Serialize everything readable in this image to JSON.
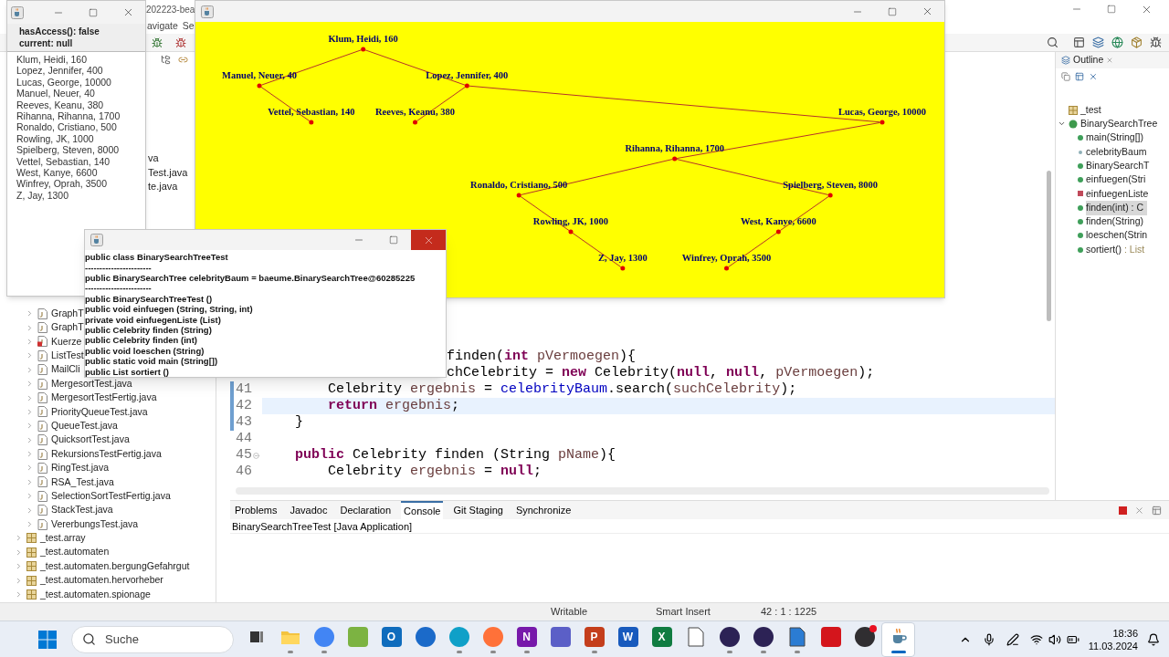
{
  "eclipse": {
    "title": "202223-bea",
    "menu": [
      "avigate",
      "Se"
    ]
  },
  "package_explorer": {
    "fragments": [
      "va",
      "Test.java",
      "te.java"
    ],
    "items": [
      {
        "label": "GraphT",
        "kind": "file",
        "problem": false
      },
      {
        "label": "GraphT",
        "kind": "file",
        "problem": false
      },
      {
        "label": "Kuerze",
        "kind": "file",
        "problem": true
      },
      {
        "label": "ListTest",
        "kind": "file",
        "problem": false
      },
      {
        "label": "MailCli",
        "kind": "file",
        "problem": false
      },
      {
        "label": "MergesortTest.java",
        "kind": "file",
        "problem": false
      },
      {
        "label": "MergesortTestFertig.java",
        "kind": "file",
        "problem": false
      },
      {
        "label": "PriorityQueueTest.java",
        "kind": "file",
        "problem": false
      },
      {
        "label": "QueueTest.java",
        "kind": "file",
        "problem": false
      },
      {
        "label": "QuicksortTest.java",
        "kind": "file",
        "problem": false
      },
      {
        "label": "RekursionsTestFertig.java",
        "kind": "file",
        "problem": false
      },
      {
        "label": "RingTest.java",
        "kind": "file",
        "problem": false
      },
      {
        "label": "RSA_Test.java",
        "kind": "file",
        "problem": false
      },
      {
        "label": "SelectionSortTestFertig.java",
        "kind": "file",
        "problem": false
      },
      {
        "label": "StackTest.java",
        "kind": "file",
        "problem": false
      },
      {
        "label": "VererbungsTest.java",
        "kind": "file",
        "problem": false
      },
      {
        "label": "_test.array",
        "kind": "package"
      },
      {
        "label": "_test.automaten",
        "kind": "package"
      },
      {
        "label": "_test.automaten.bergungGefahrgut",
        "kind": "package"
      },
      {
        "label": "_test.automaten.hervorheber",
        "kind": "package"
      },
      {
        "label": "_test.automaten.spionage",
        "kind": "package"
      }
    ]
  },
  "editor": {
    "lines": [
      {
        "kind": "partial",
        "tokens": [
          {
            "text": "finden(",
            "kind": "plain"
          },
          {
            "text": "int",
            "kind": "kw"
          },
          {
            "text": " pVermoegen",
            "kind": "var"
          },
          {
            "text": "){",
            "kind": "plain"
          }
        ]
      },
      {
        "kind": "partial",
        "tokens": [
          {
            "text": "chCelebrity = ",
            "kind": "plain"
          },
          {
            "text": "new",
            "kind": "kw"
          },
          {
            "text": " Celebrity(",
            "kind": "plain"
          },
          {
            "text": "null",
            "kind": "kw"
          },
          {
            "text": ", ",
            "kind": "plain"
          },
          {
            "text": "null",
            "kind": "kw"
          },
          {
            "text": ", ",
            "kind": "plain"
          },
          {
            "text": "pVermoegen",
            "kind": "var"
          },
          {
            "text": ");",
            "kind": "plain"
          }
        ]
      },
      {
        "kind": "full",
        "number": "41",
        "current": false,
        "changed": true,
        "fold": false,
        "tokens": [
          {
            "text": "        Celebrity ",
            "kind": "plain"
          },
          {
            "text": "ergebnis",
            "kind": "var"
          },
          {
            "text": " = ",
            "kind": "plain"
          },
          {
            "text": "celebrityBaum",
            "kind": "field"
          },
          {
            "text": ".search(",
            "kind": "plain"
          },
          {
            "text": "suchCelebrity",
            "kind": "var"
          },
          {
            "text": ");",
            "kind": "plain"
          }
        ]
      },
      {
        "kind": "full",
        "number": "42",
        "current": true,
        "changed": true,
        "fold": false,
        "tokens": [
          {
            "text": "        return",
            "kind": "kw"
          },
          {
            "text": " ergebnis",
            "kind": "var"
          },
          {
            "text": ";",
            "kind": "plain"
          }
        ]
      },
      {
        "kind": "full",
        "number": "43",
        "current": false,
        "changed": true,
        "fold": false,
        "tokens": [
          {
            "text": "    }",
            "kind": "plain"
          }
        ]
      },
      {
        "kind": "full",
        "number": "44",
        "current": false,
        "changed": false,
        "fold": false
      },
      {
        "kind": "full",
        "number": "45",
        "current": false,
        "changed": false,
        "fold": true,
        "tokens": [
          {
            "text": "    public",
            "kind": "kw"
          },
          {
            "text": " Celebrity finden (String ",
            "kind": "plain"
          },
          {
            "text": "pName",
            "kind": "var"
          },
          {
            "text": "){",
            "kind": "plain"
          }
        ]
      },
      {
        "kind": "full",
        "number": "46",
        "current": false,
        "changed": false,
        "fold": false,
        "tokens": [
          {
            "text": "        Celebrity ",
            "kind": "plain"
          },
          {
            "text": "ergebnis",
            "kind": "var"
          },
          {
            "text": " = ",
            "kind": "plain"
          },
          {
            "text": "null",
            "kind": "kw"
          },
          {
            "text": ";",
            "kind": "plain"
          }
        ]
      }
    ]
  },
  "outline": {
    "title": "Outline",
    "items": [
      {
        "label": "_test",
        "kind": "package",
        "selected": false
      },
      {
        "label": "BinarySearchTree",
        "kind": "class",
        "selected": false,
        "expanded": true,
        "children": [
          {
            "label": "main(String[])",
            "kind": "method",
            "selected": false
          },
          {
            "label": "celebrityBaum",
            "kind": "field",
            "selected": false
          },
          {
            "label": "BinarySearchT",
            "kind": "method",
            "selected": false
          },
          {
            "label": "einfuegen(Stri",
            "kind": "method",
            "selected": false
          },
          {
            "label": "einfuegenListe",
            "kind": "private_method",
            "selected": false
          },
          {
            "label": "finden(int) : C",
            "kind": "method",
            "selected": true
          },
          {
            "label": "finden(String)",
            "kind": "method",
            "selected": false
          },
          {
            "label": "loeschen(Strin",
            "kind": "method",
            "selected": false
          },
          {
            "label": "sortiert()",
            "type": " : List",
            "kind": "method",
            "selected": false
          }
        ]
      }
    ]
  },
  "bottom_panel": {
    "tabs": [
      {
        "label": "Problems",
        "selected": false
      },
      {
        "label": "Javadoc",
        "selected": false
      },
      {
        "label": "Declaration",
        "selected": false
      },
      {
        "label": "Console",
        "selected": true
      },
      {
        "label": "Git Staging",
        "selected": false
      },
      {
        "label": "Synchronize",
        "selected": false
      }
    ],
    "console_title": "BinarySearchTreeTest [Java Application]"
  },
  "status_bar": [
    "Writable",
    "Smart Insert",
    "42 : 1 : 1225"
  ],
  "list_window": {
    "header": [
      "hasAccess(): false",
      "current: null"
    ],
    "items": [
      "Klum, Heidi, 160",
      "Lopez, Jennifer, 400",
      "Lucas, George, 10000",
      "Manuel, Neuer, 40",
      "Reeves, Keanu, 380",
      "Rihanna, Rihanna, 1700",
      "Ronaldo, Cristiano, 500",
      "Rowling, JK, 1000",
      "Spielberg, Steven, 8000",
      "Vettel, Sebastian, 140",
      "West, Kanye, 6600",
      "Winfrey, Oprah, 3500",
      "Z, Jay, 1300"
    ]
  },
  "tree_window": {
    "root": {
      "label": "Klum, Heidi, 160",
      "children": [
        {
          "kind": "left",
          "label": "Manuel, Neuer, 40",
          "children": [
            {
              "kind": "right",
              "label": "Vettel, Sebastian, 140"
            }
          ]
        },
        {
          "kind": "right",
          "label": "Lopez, Jennifer, 400",
          "children": [
            {
              "kind": "left",
              "label": "Reeves, Keanu, 380"
            },
            {
              "kind": "right",
              "label": "Lucas, George, 10000",
              "children": [
                {
                  "kind": "left",
                  "label": "Rihanna, Rihanna, 1700",
                  "children": [
                    {
                      "kind": "left",
                      "label": "Ronaldo, Cristiano, 500",
                      "children": [
                        {
                          "kind": "right",
                          "label": "Rowling, JK, 1000",
                          "children": [
                            {
                              "kind": "right",
                              "label": "Z, Jay, 1300"
                            }
                          ]
                        }
                      ]
                    },
                    {
                      "kind": "right",
                      "label": "Spielberg, Steven, 8000",
                      "children": [
                        {
                          "kind": "left",
                          "label": "West, Kanye, 6600",
                          "children": [
                            {
                              "kind": "left",
                              "label": "Winfrey, Oprah, 3500"
                            }
                          ]
                        }
                      ]
                    }
                  ]
                }
              ]
            }
          ]
        }
      ]
    }
  },
  "methods_window": {
    "lines": [
      "public class BinarySearchTreeTest",
      "-----------------------",
      "public BinarySearchTree celebrityBaum = baeume.BinarySearchTree@60285225",
      "-----------------------",
      "public BinarySearchTreeTest ()",
      "public void einfuegen (String, String, int)",
      "private void einfuegenListe (List)",
      "public Celebrity finden (String)",
      "public Celebrity finden (int)",
      "public void loeschen (String)",
      "public static void main (String[])",
      "public List sortiert ()"
    ]
  },
  "taskbar": {
    "search_placeholder": "Suche",
    "time": "18:36",
    "date": "11.03.2024",
    "apps": [
      {
        "kind": "taskview",
        "running": false,
        "active": false
      },
      {
        "kind": "folder",
        "running": true,
        "active": false
      },
      {
        "kind": "round",
        "color": "#4285f4",
        "running": true,
        "active": false
      },
      {
        "kind": "tile",
        "color": "#7cb342",
        "running": false,
        "active": false
      },
      {
        "kind": "tile",
        "color": "#0f6cbd",
        "letter": "O",
        "running": false,
        "active": false
      },
      {
        "kind": "round",
        "color": "#1b6ac9",
        "running": false,
        "active": false
      },
      {
        "kind": "round",
        "color": "#0fa0c8",
        "running": true,
        "active": false
      },
      {
        "kind": "round",
        "color": "#ff7139",
        "running": true,
        "active": false
      },
      {
        "kind": "tile",
        "color": "#7719aa",
        "letter": "N",
        "running": true,
        "active": false
      },
      {
        "kind": "tile",
        "color": "#5b5fc7",
        "running": false,
        "active": false
      },
      {
        "kind": "tile",
        "color": "#c43e1c",
        "letter": "P",
        "running": true,
        "active": false
      },
      {
        "kind": "tile",
        "color": "#185abd",
        "letter": "W",
        "running": false,
        "active": false
      },
      {
        "kind": "tile",
        "color": "#107c41",
        "letter": "X",
        "running": false,
        "active": false
      },
      {
        "kind": "page",
        "color": "#ffffff",
        "running": false,
        "active": false
      },
      {
        "kind": "round",
        "color": "#2c2255",
        "running": true,
        "active": false
      },
      {
        "kind": "round",
        "color": "#2c2255",
        "running": true,
        "active": false
      },
      {
        "kind": "page",
        "color": "#2b7cd3",
        "running": true,
        "active": false
      },
      {
        "kind": "tile",
        "color": "#d4151c",
        "running": false,
        "active": false
      },
      {
        "kind": "round",
        "color": "#302e31",
        "badge": true,
        "running": false,
        "active": false
      },
      {
        "kind": "java",
        "running": true,
        "active": true
      }
    ]
  }
}
